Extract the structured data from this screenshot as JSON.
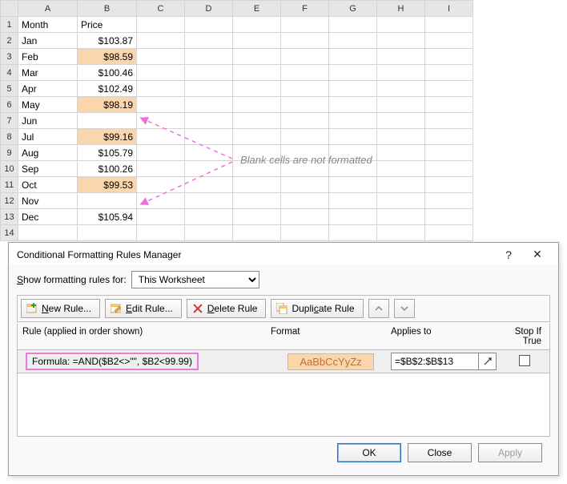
{
  "columns": [
    "A",
    "B",
    "C",
    "D",
    "E",
    "F",
    "G",
    "H",
    "I"
  ],
  "header": {
    "A": "Month",
    "B": "Price"
  },
  "rows": [
    {
      "n": 1,
      "A": "Month",
      "B": "Price",
      "bold": true
    },
    {
      "n": 2,
      "A": "Jan",
      "B": "$103.87"
    },
    {
      "n": 3,
      "A": "Feb",
      "B": "$98.59",
      "hl": true
    },
    {
      "n": 4,
      "A": "Mar",
      "B": "$100.46"
    },
    {
      "n": 5,
      "A": "Apr",
      "B": "$102.49"
    },
    {
      "n": 6,
      "A": "May",
      "B": "$98.19",
      "hl": true
    },
    {
      "n": 7,
      "A": "Jun",
      "B": ""
    },
    {
      "n": 8,
      "A": "Jul",
      "B": "$99.16",
      "hl": true
    },
    {
      "n": 9,
      "A": "Aug",
      "B": "$105.79"
    },
    {
      "n": 10,
      "A": "Sep",
      "B": "$100.26"
    },
    {
      "n": 11,
      "A": "Oct",
      "B": "$99.53",
      "hl": true
    },
    {
      "n": 12,
      "A": "Nov",
      "B": ""
    },
    {
      "n": 13,
      "A": "Dec",
      "B": "$105.94"
    },
    {
      "n": 14,
      "A": "",
      "B": ""
    }
  ],
  "annotation": "Blank cells are not formatted",
  "dialog": {
    "title": "Conditional Formatting Rules Manager",
    "show_label_pre": "S",
    "show_label_rest": "how formatting rules for:",
    "scope_value": "This Worksheet",
    "toolbar": {
      "new": "New Rule...",
      "edit": "Edit Rule...",
      "delete": "Delete Rule",
      "duplicate": "Duplicate Rule"
    },
    "cols": {
      "rule": "Rule (applied in order shown)",
      "format": "Format",
      "applies": "Applies to",
      "stop": "Stop If True"
    },
    "rule": {
      "text": "Formula: =AND($B2<>\"\", $B2<99.99)",
      "preview": "AaBbCcYyZz",
      "applies": "=$B$2:$B$13"
    },
    "buttons": {
      "ok": "OK",
      "close": "Close",
      "apply": "Apply"
    }
  }
}
